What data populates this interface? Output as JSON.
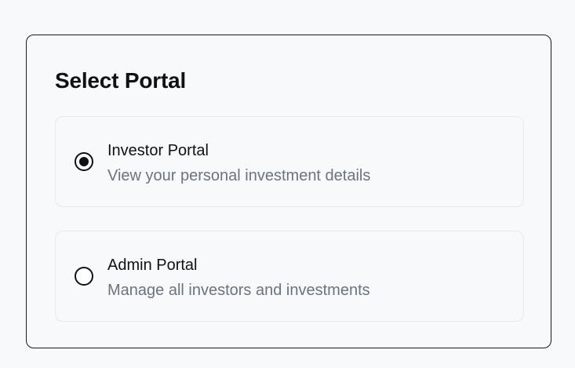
{
  "title": "Select Portal",
  "options": [
    {
      "label": "Investor Portal",
      "description": "View your personal investment details",
      "selected": true
    },
    {
      "label": "Admin Portal",
      "description": "Manage all investors and investments",
      "selected": false
    }
  ],
  "colors": {
    "background": "#f8f9fb",
    "card_border": "#1a1a1a",
    "option_border": "#e6e8ec",
    "title_text": "#111111",
    "description_text": "#6b7280"
  }
}
